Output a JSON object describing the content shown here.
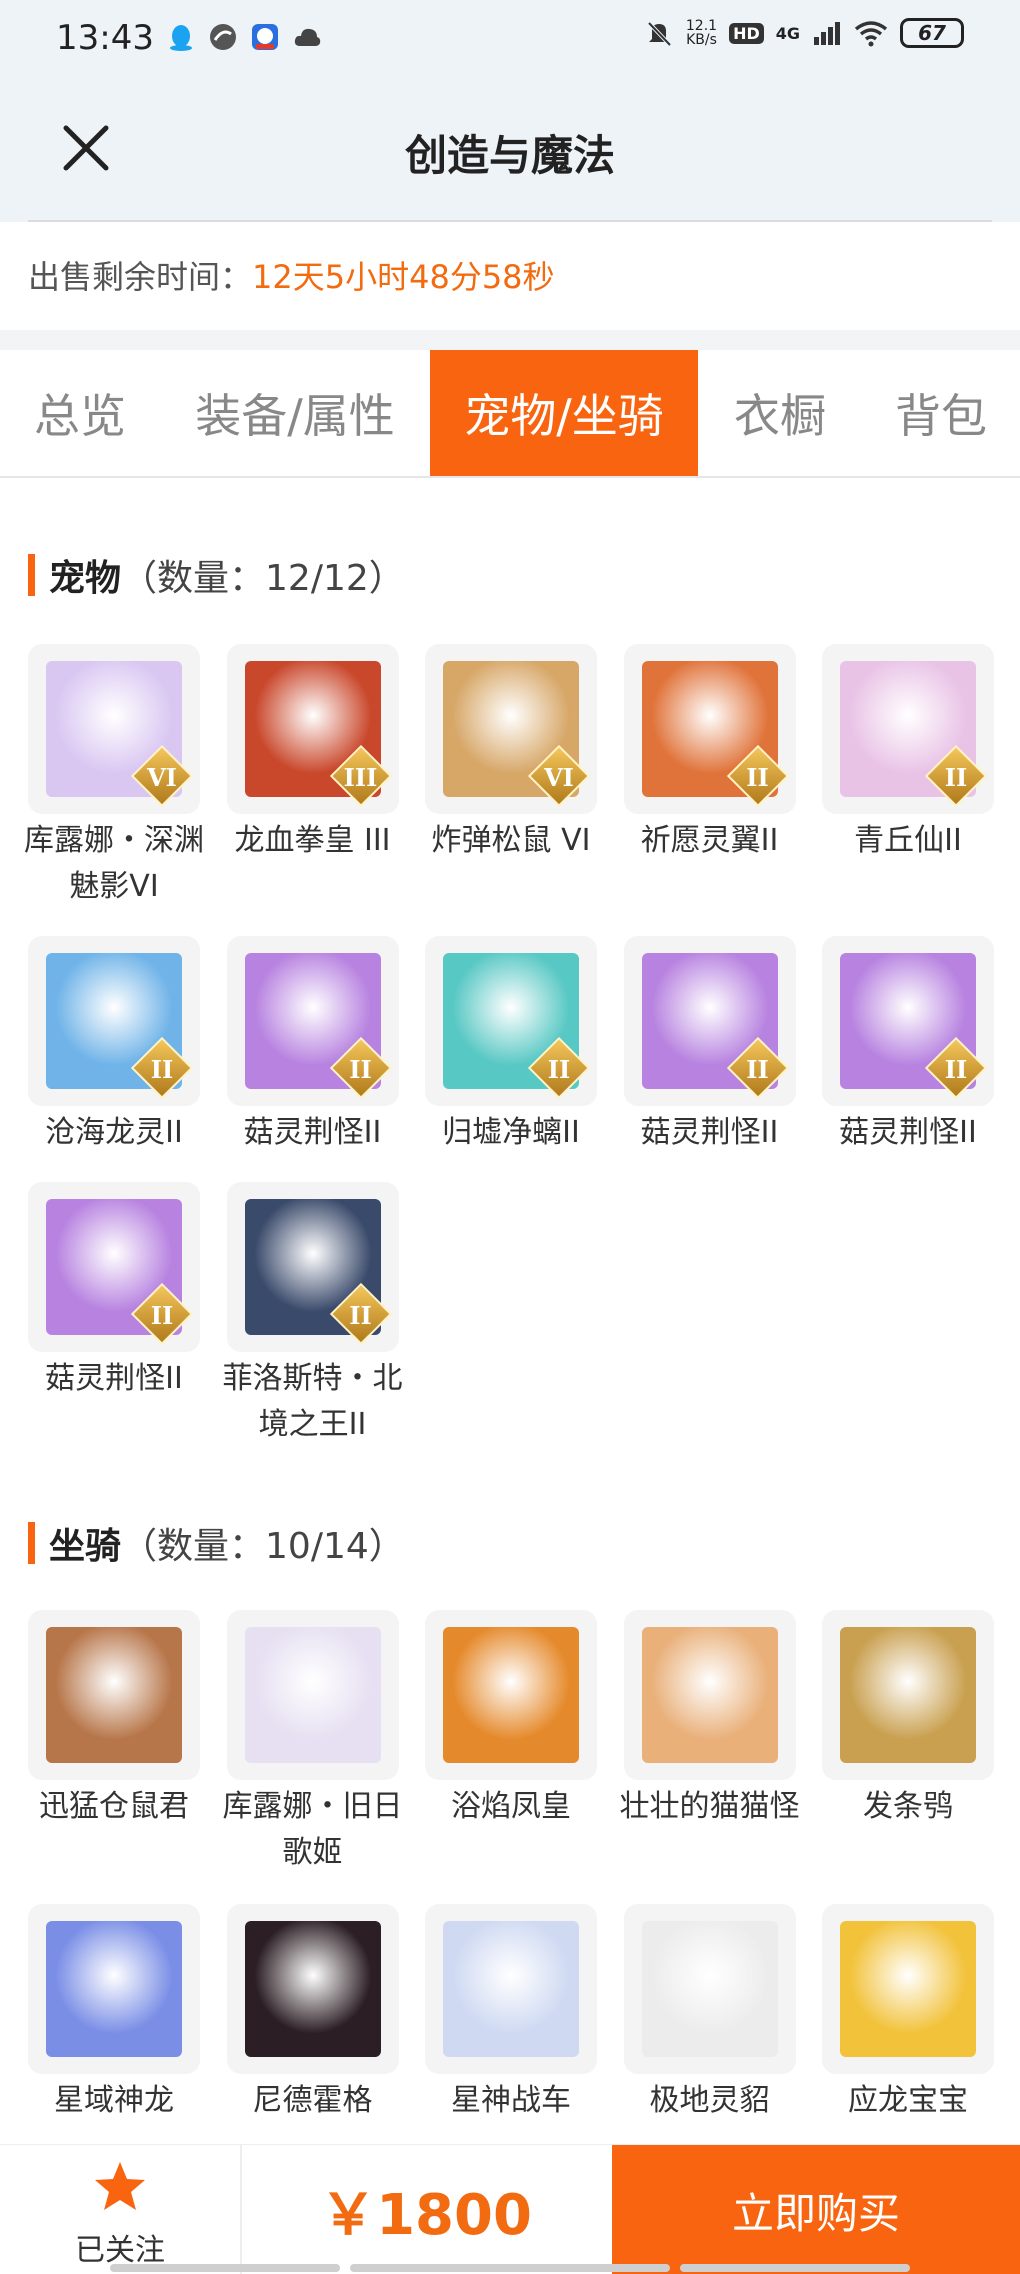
{
  "status_bar": {
    "time": "13:43",
    "net_speed_value": "12.1",
    "net_speed_unit": "KB/s",
    "hd_label": "HD",
    "network_label": "4G",
    "battery": "67",
    "icons_left": [
      "qq-icon",
      "app-icon",
      "k-app-icon",
      "cloud-icon"
    ]
  },
  "header": {
    "title": "创造与魔法"
  },
  "sale": {
    "label": "出售剩余时间：",
    "remaining": "12天5小时48分58秒"
  },
  "tabs": [
    {
      "label": "总览",
      "active": false
    },
    {
      "label": "装备/属性",
      "active": false
    },
    {
      "label": "宠物/坐骑",
      "active": true
    },
    {
      "label": "衣橱",
      "active": false
    },
    {
      "label": "背包",
      "active": false
    }
  ],
  "pets": {
    "title": "宠物",
    "count": "（数量：12/12）",
    "items": [
      {
        "name": "库露娜・深渊魅影VI",
        "grade": "VI",
        "color": "#d9c7f2"
      },
      {
        "name": "龙血拳皇 III",
        "grade": "III",
        "color": "#c9472b"
      },
      {
        "name": "炸弹松鼠 VI",
        "grade": "VI",
        "color": "#d7a768"
      },
      {
        "name": "祈愿灵翼II",
        "grade": "II",
        "color": "#e0733a"
      },
      {
        "name": "青丘仙II",
        "grade": "II",
        "color": "#e9c3e6"
      },
      {
        "name": "沧海龙灵II",
        "grade": "II",
        "color": "#6fb3e8"
      },
      {
        "name": "菇灵荆怪II",
        "grade": "II",
        "color": "#b782e0"
      },
      {
        "name": "归墟净螭II",
        "grade": "II",
        "color": "#58c8c4"
      },
      {
        "name": "菇灵荆怪II",
        "grade": "II",
        "color": "#b782e0"
      },
      {
        "name": "菇灵荆怪II",
        "grade": "II",
        "color": "#b782e0"
      },
      {
        "name": "菇灵荆怪II",
        "grade": "II",
        "color": "#b782e0"
      },
      {
        "name": "菲洛斯特・北境之王II",
        "grade": "II",
        "color": "#3a4a6b"
      }
    ]
  },
  "mounts": {
    "title": "坐骑",
    "count": "（数量：10/14）",
    "items": [
      {
        "name": "迅猛仓鼠君",
        "color": "#b7764a"
      },
      {
        "name": "库露娜・旧日歌姬",
        "color": "#e6e0f2"
      },
      {
        "name": "浴焰凤皇",
        "color": "#e58a2c"
      },
      {
        "name": "壮壮的猫猫怪",
        "color": "#e9b07a"
      },
      {
        "name": "发条鸮",
        "color": "#c9a050"
      },
      {
        "name": "星域神龙",
        "color": "#7a8ee6"
      },
      {
        "name": "尼德霍格",
        "color": "#2b1e24"
      },
      {
        "name": "星神战车",
        "color": "#cfd9f2"
      },
      {
        "name": "极地灵貂",
        "color": "#ececec"
      },
      {
        "name": "应龙宝宝",
        "color": "#f2c23a"
      }
    ]
  },
  "bottom": {
    "follow_label": "已关注",
    "price": "￥1800",
    "buy_label": "立即购买"
  },
  "colors": {
    "accent": "#f8640f",
    "remain_text": "#f26b10",
    "header_bg": "#eef3f8"
  }
}
